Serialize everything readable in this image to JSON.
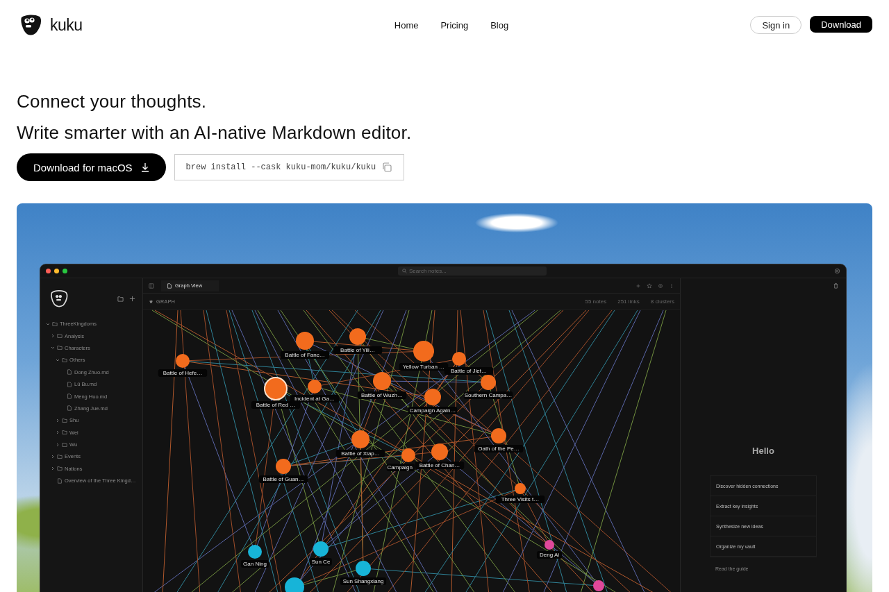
{
  "header": {
    "logo_text": "kuku",
    "nav": [
      "Home",
      "Pricing",
      "Blog"
    ],
    "sign_in": "Sign in",
    "download": "Download"
  },
  "hero": {
    "title": "Connect your thoughts.",
    "subtitle": "Write smarter with an AI-native Markdown editor.",
    "download_button": "Download for macOS",
    "brew_command": "brew install --cask kuku-mom/kuku/kuku"
  },
  "app_window": {
    "search": {
      "placeholder": "Search notes..."
    },
    "tab": "Graph View",
    "section": "GRAPH",
    "stats": [
      "55 notes",
      "251 links",
      "8 clusters"
    ],
    "tree": [
      {
        "label": "ThreeKingdoms",
        "kind": "folder",
        "expanded": true,
        "children": [
          {
            "label": "Analysis",
            "kind": "folder",
            "expanded": false
          },
          {
            "label": "Characters",
            "kind": "folder",
            "expanded": true,
            "children": [
              {
                "label": "Others",
                "kind": "folder",
                "expanded": true,
                "children": [
                  {
                    "label": "Dong Zhuo.md",
                    "kind": "file"
                  },
                  {
                    "label": "Lü Bu.md",
                    "kind": "file"
                  },
                  {
                    "label": "Meng Huo.md",
                    "kind": "file"
                  },
                  {
                    "label": "Zhang Jue.md",
                    "kind": "file"
                  }
                ]
              },
              {
                "label": "Shu",
                "kind": "folder",
                "expanded": false
              },
              {
                "label": "Wei",
                "kind": "folder",
                "expanded": false
              },
              {
                "label": "Wu",
                "kind": "folder",
                "expanded": false
              }
            ]
          },
          {
            "label": "Events",
            "kind": "folder",
            "expanded": false
          },
          {
            "label": "Nations",
            "kind": "folder",
            "expanded": false
          },
          {
            "label": "Overview of the Three Kingd…",
            "kind": "file"
          }
        ]
      }
    ],
    "graph_nodes": [
      {
        "label": "Battle of Hefe…",
        "color": "#f26b1d",
        "selected": false
      },
      {
        "label": "Battle of Fanc…",
        "color": "#f26b1d",
        "selected": false
      },
      {
        "label": "Battle of Yili…",
        "color": "#f26b1d",
        "selected": false
      },
      {
        "label": "Yellow Turban …",
        "color": "#f26b1d",
        "selected": false
      },
      {
        "label": "Battle of Jiet…",
        "color": "#f26b1d",
        "selected": false
      },
      {
        "label": "Battle of Red …",
        "color": "#f26b1d",
        "selected": true
      },
      {
        "label": "Incident at Ga…",
        "color": "#f26b1d",
        "selected": false
      },
      {
        "label": "Battle of Wuzh…",
        "color": "#f26b1d",
        "selected": false
      },
      {
        "label": "Southern Campa…",
        "color": "#f26b1d",
        "selected": false
      },
      {
        "label": "Campaign Again…",
        "color": "#f26b1d",
        "selected": false
      },
      {
        "label": "Battle of Xiap…",
        "color": "#f26b1d",
        "selected": false
      },
      {
        "label": "Campaign",
        "color": "#f26b1d",
        "selected": false
      },
      {
        "label": "Battle of Chan…",
        "color": "#f26b1d",
        "selected": false
      },
      {
        "label": "Oath of the Pe…",
        "color": "#f26b1d",
        "selected": false
      },
      {
        "label": "Battle of Guan…",
        "color": "#f26b1d",
        "selected": false
      },
      {
        "label": "Three Visits t…",
        "color": "#f26b1d",
        "selected": false
      },
      {
        "label": "Gan Ning",
        "color": "#17b4d8",
        "selected": false
      },
      {
        "label": "Sun Ce",
        "color": "#17b4d8",
        "selected": false
      },
      {
        "label": "Sun Shangxiang",
        "color": "#17b4d8",
        "selected": false
      },
      {
        "color": "#17b4d8",
        "selected": false
      },
      {
        "label": "Deng Ai",
        "color": "#e0489a",
        "selected": false
      },
      {
        "color": "#e0489a",
        "selected": false
      }
    ],
    "assistant": {
      "greeting": "Hello",
      "suggestions": [
        "Discover hidden connections",
        "Extract key insights",
        "Synthesize new ideas",
        "Organize my vault"
      ],
      "guide_link": "Read the guide"
    }
  }
}
